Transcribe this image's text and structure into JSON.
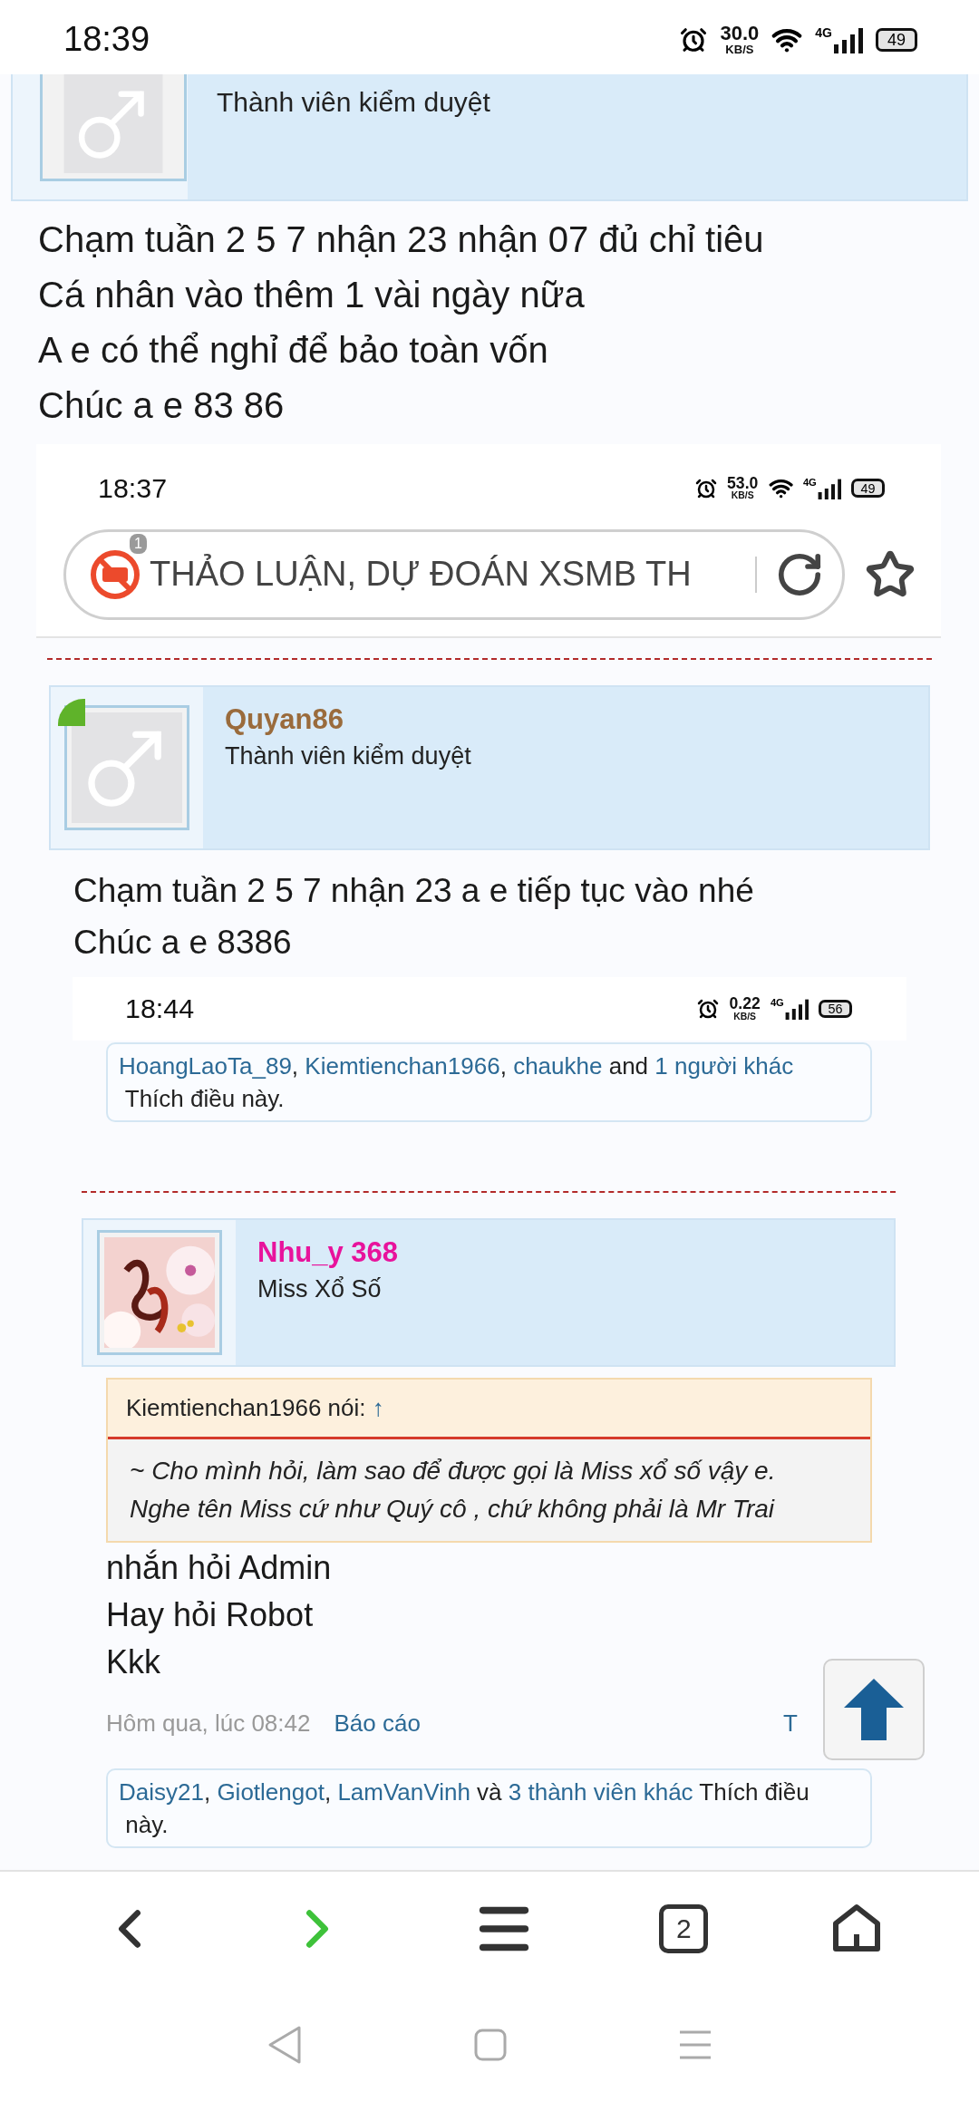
{
  "status_bar": {
    "time": "18:39",
    "speed": "30.0",
    "speed_unit": "KB/S",
    "network_type": "4G",
    "battery": "49"
  },
  "top_card": {
    "role": "Thành viên kiểm duyệt"
  },
  "post_1_lines": [
    "Chạm tuần 2 5 7 nhận 23 nhận 07 đủ chỉ tiêu",
    "Cá nhân vào thêm 1 vài ngày nữa",
    "A e có thể nghỉ để bảo toàn vốn",
    "Chúc a e 83 86"
  ],
  "embedded_screenshot_1": {
    "status_bar": {
      "time": "18:37",
      "speed": "53.0",
      "speed_unit": "KB/S",
      "network_type": "4G",
      "battery": "49"
    },
    "address_bar": {
      "badge": "1",
      "title": "THẢO LUẬN, DỰ ĐOÁN XSMB TH"
    }
  },
  "post_2": {
    "author": {
      "name": "Quyan86",
      "color": "#9a6b3c",
      "role": "Thành viên kiểm duyệt",
      "online": true
    },
    "lines": [
      "Chạm tuần 2 5 7 nhận 23 a e tiếp tục vào nhé",
      "Chúc a e 8386"
    ]
  },
  "embedded_screenshot_2": {
    "status_bar": {
      "time": "18:44",
      "speed": "0.22",
      "speed_unit": "KB/S",
      "network_type": "4G",
      "battery": "56"
    }
  },
  "likes_1": [
    {
      "text": "HoangLaoTa_89",
      "link": true
    },
    {
      "text": ", ",
      "link": false
    },
    {
      "text": "Kiemtienchan1966",
      "link": true
    },
    {
      "text": ", ",
      "link": false
    },
    {
      "text": "chaukhe",
      "link": true
    },
    {
      "text": " and ",
      "link": false
    },
    {
      "text": "1 người khác",
      "link": true
    },
    {
      "text": " Thích điều này.",
      "link": false
    }
  ],
  "post_3": {
    "author": {
      "name": "Nhu_y 368",
      "color": "#e8139c",
      "role": "Miss Xổ Số"
    },
    "quote": {
      "author": "Kiemtienchan1966 nói:",
      "jump": "↑",
      "lines": [
        "~ Cho mình hỏi, làm sao để được gọi là Miss xổ số vậy e.",
        "Nghe tên Miss cứ như Quý cô , chứ không phải là Mr Trai"
      ]
    },
    "lines": [
      "nhắn hỏi Admin",
      "Hay hỏi Robot",
      "Kkk"
    ],
    "meta": {
      "time": "Hôm qua, lúc 08:42",
      "report": "Báo cáo",
      "cut_link": "T"
    }
  },
  "likes_2": [
    {
      "text": "Daisy21",
      "link": true
    },
    {
      "text": ", ",
      "link": false
    },
    {
      "text": "Giotlengot",
      "link": true
    },
    {
      "text": ", ",
      "link": false
    },
    {
      "text": "LamVanVinh",
      "link": true
    },
    {
      "text": " và ",
      "link": false
    },
    {
      "text": "3 thành viên khác",
      "link": true
    },
    {
      "text": " Thích điều",
      "link": false
    },
    {
      "text": " này.",
      "link": false
    }
  ],
  "bottom_nav": {
    "forward_enabled": true,
    "tab_count": "2"
  }
}
